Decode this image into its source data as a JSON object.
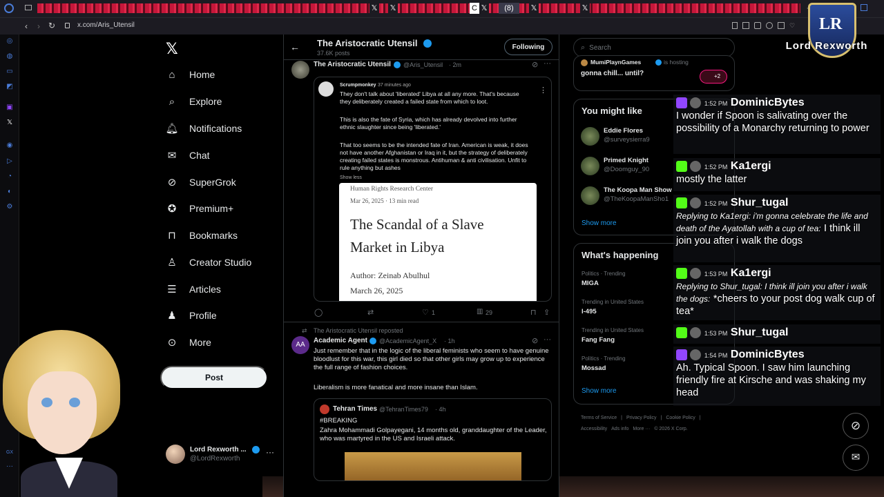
{
  "browser": {
    "url": "x.com/Aris_Utensil",
    "tab_badge": "(8)"
  },
  "nav": {
    "items": [
      {
        "label": "Home",
        "icon": "home-icon"
      },
      {
        "label": "Explore",
        "icon": "search-icon"
      },
      {
        "label": "Notifications",
        "icon": "bell-icon"
      },
      {
        "label": "Chat",
        "icon": "mail-icon"
      },
      {
        "label": "SuperGrok",
        "icon": "grok-icon"
      },
      {
        "label": "Premium+",
        "icon": "premium-icon"
      },
      {
        "label": "Bookmarks",
        "icon": "bookmark-icon"
      },
      {
        "label": "Creator Studio",
        "icon": "creator-icon"
      },
      {
        "label": "Articles",
        "icon": "article-icon"
      },
      {
        "label": "Profile",
        "icon": "profile-icon"
      },
      {
        "label": "More",
        "icon": "more-icon"
      }
    ],
    "post_label": "Post",
    "account": {
      "name": "Lord Rexworth ...",
      "handle": "@LordRexworth"
    }
  },
  "header": {
    "title": "The Aristocratic Utensil",
    "posts": "37.6K posts",
    "follow_label": "Following"
  },
  "tweet1": {
    "name": "The Aristocratic Utensil",
    "handle": "@Aris_Utensil",
    "time": "· 2m",
    "quote_user": "Scrumpmonkey",
    "quote_time": "37 minutes ago",
    "quote_p1": "They don't talk about 'liberated' Libya at all any more. That's because they deliberately created a failed state from which to loot.",
    "quote_p2": "This is also the fate of Syria, which has already devolved into further ethnic slaughter since being 'liberated.'",
    "quote_p3": "That too seems to be the intended fate of Iran. American is weak, it does not have another Afghanistan or Iraq in it, but the strategy of deliberately creating failed states is monstrous. Antihuman & anti civilisation. Unfit to rule anything but ashes",
    "show_less": "Show less",
    "article_source": "Human Rights Research Center",
    "article_meta": "Mar 26, 2025 · 13 min read",
    "article_title": "The Scandal of a Slave Market in Libya",
    "article_author": "Author: Zeinab Abulhul",
    "article_date": "March 26, 2025",
    "likes": "1",
    "views": "29"
  },
  "tweet2": {
    "repost_label": "The Aristocratic Utensil reposted",
    "name": "Academic Agent",
    "handle": "@AcademicAgent_X",
    "time": "· 1h",
    "text1": "Just remember that in the logic of the liberal feminists who seem to have genuine bloodlust for this war, this girl died so that other girls may grow up to experience the full range of fashion choices.",
    "text2": "Liberalism is more fanatical and more insane than Islam.",
    "quote_name": "Tehran Times",
    "quote_handle": "@TehranTimes79",
    "quote_time": "· 4h",
    "quote_tag": "#BREAKING",
    "quote_text": "Zahra Mohammadi Golpayegani, 14 months old, granddaughter of the Leader, who was martyred in the US and Israeli attack."
  },
  "right": {
    "search_placeholder": "Search",
    "spaces_host": "MumiPlaynGames",
    "spaces_hosting": "is hosting",
    "spaces_title": "gonna chill... until?",
    "spaces_count": "+2",
    "wtf_title": "You might like",
    "wtf": [
      {
        "name": "Eddie Flores",
        "handle": "@surveysierra9"
      },
      {
        "name": "Primed Knight",
        "handle": "@Doomguy_90"
      },
      {
        "name": "The Koopa Man Show",
        "handle": "@TheKoopaManSho1"
      }
    ],
    "follow_label": "Follow",
    "show_more": "Show more",
    "trend_title": "What's happening",
    "trends": [
      {
        "ctx": "Politics · Trending",
        "name": "MIGA"
      },
      {
        "ctx": "Trending in United States",
        "name": "I-495"
      },
      {
        "ctx": "Trending in United States",
        "name": "Fang Fang"
      },
      {
        "ctx": "Politics · Trending",
        "name": "Mossad"
      }
    ],
    "footer": [
      "Terms of Service",
      "|",
      "Privacy Policy",
      "|",
      "Cookie Policy",
      "|",
      "Accessibility",
      "Ads info",
      "More ···",
      "© 2026 X Corp."
    ]
  },
  "logo": {
    "text": "Lord Rexworth"
  },
  "chat": [
    {
      "time": "1:52 PM",
      "name": "DominicBytes",
      "text": "I wonder if Spoon is salivating over the possibility of a Monarchy returning to power"
    },
    {
      "time": "1:52 PM",
      "name": "Ka1ergi",
      "text": "mostly the latter"
    },
    {
      "time": "1:52 PM",
      "name": "Shur_tugal",
      "reply": "Replying to Ka1ergi: i'm gonna celebrate the life and death of the Ayatollah with a cup of tea:",
      "text": "I think ill join you after i walk the dogs"
    },
    {
      "time": "1:53 PM",
      "name": "Ka1ergi",
      "reply": "Replying to Shur_tugal: I think ill join you after i walk the dogs:",
      "text": "*cheers to your post dog walk cup of tea*"
    },
    {
      "time": "1:53 PM",
      "name": "Shur_tugal",
      "text": ""
    },
    {
      "time": "1:54 PM",
      "name": "DominicBytes",
      "text": "Ah. Typical Spoon. I saw him launching friendly fire at Kirsche and was shaking my head"
    }
  ],
  "colors": {
    "verified": "#1d9bf0",
    "twitch": "#9146ff",
    "kick": "#53fc18",
    "tab": "#c5173a"
  }
}
